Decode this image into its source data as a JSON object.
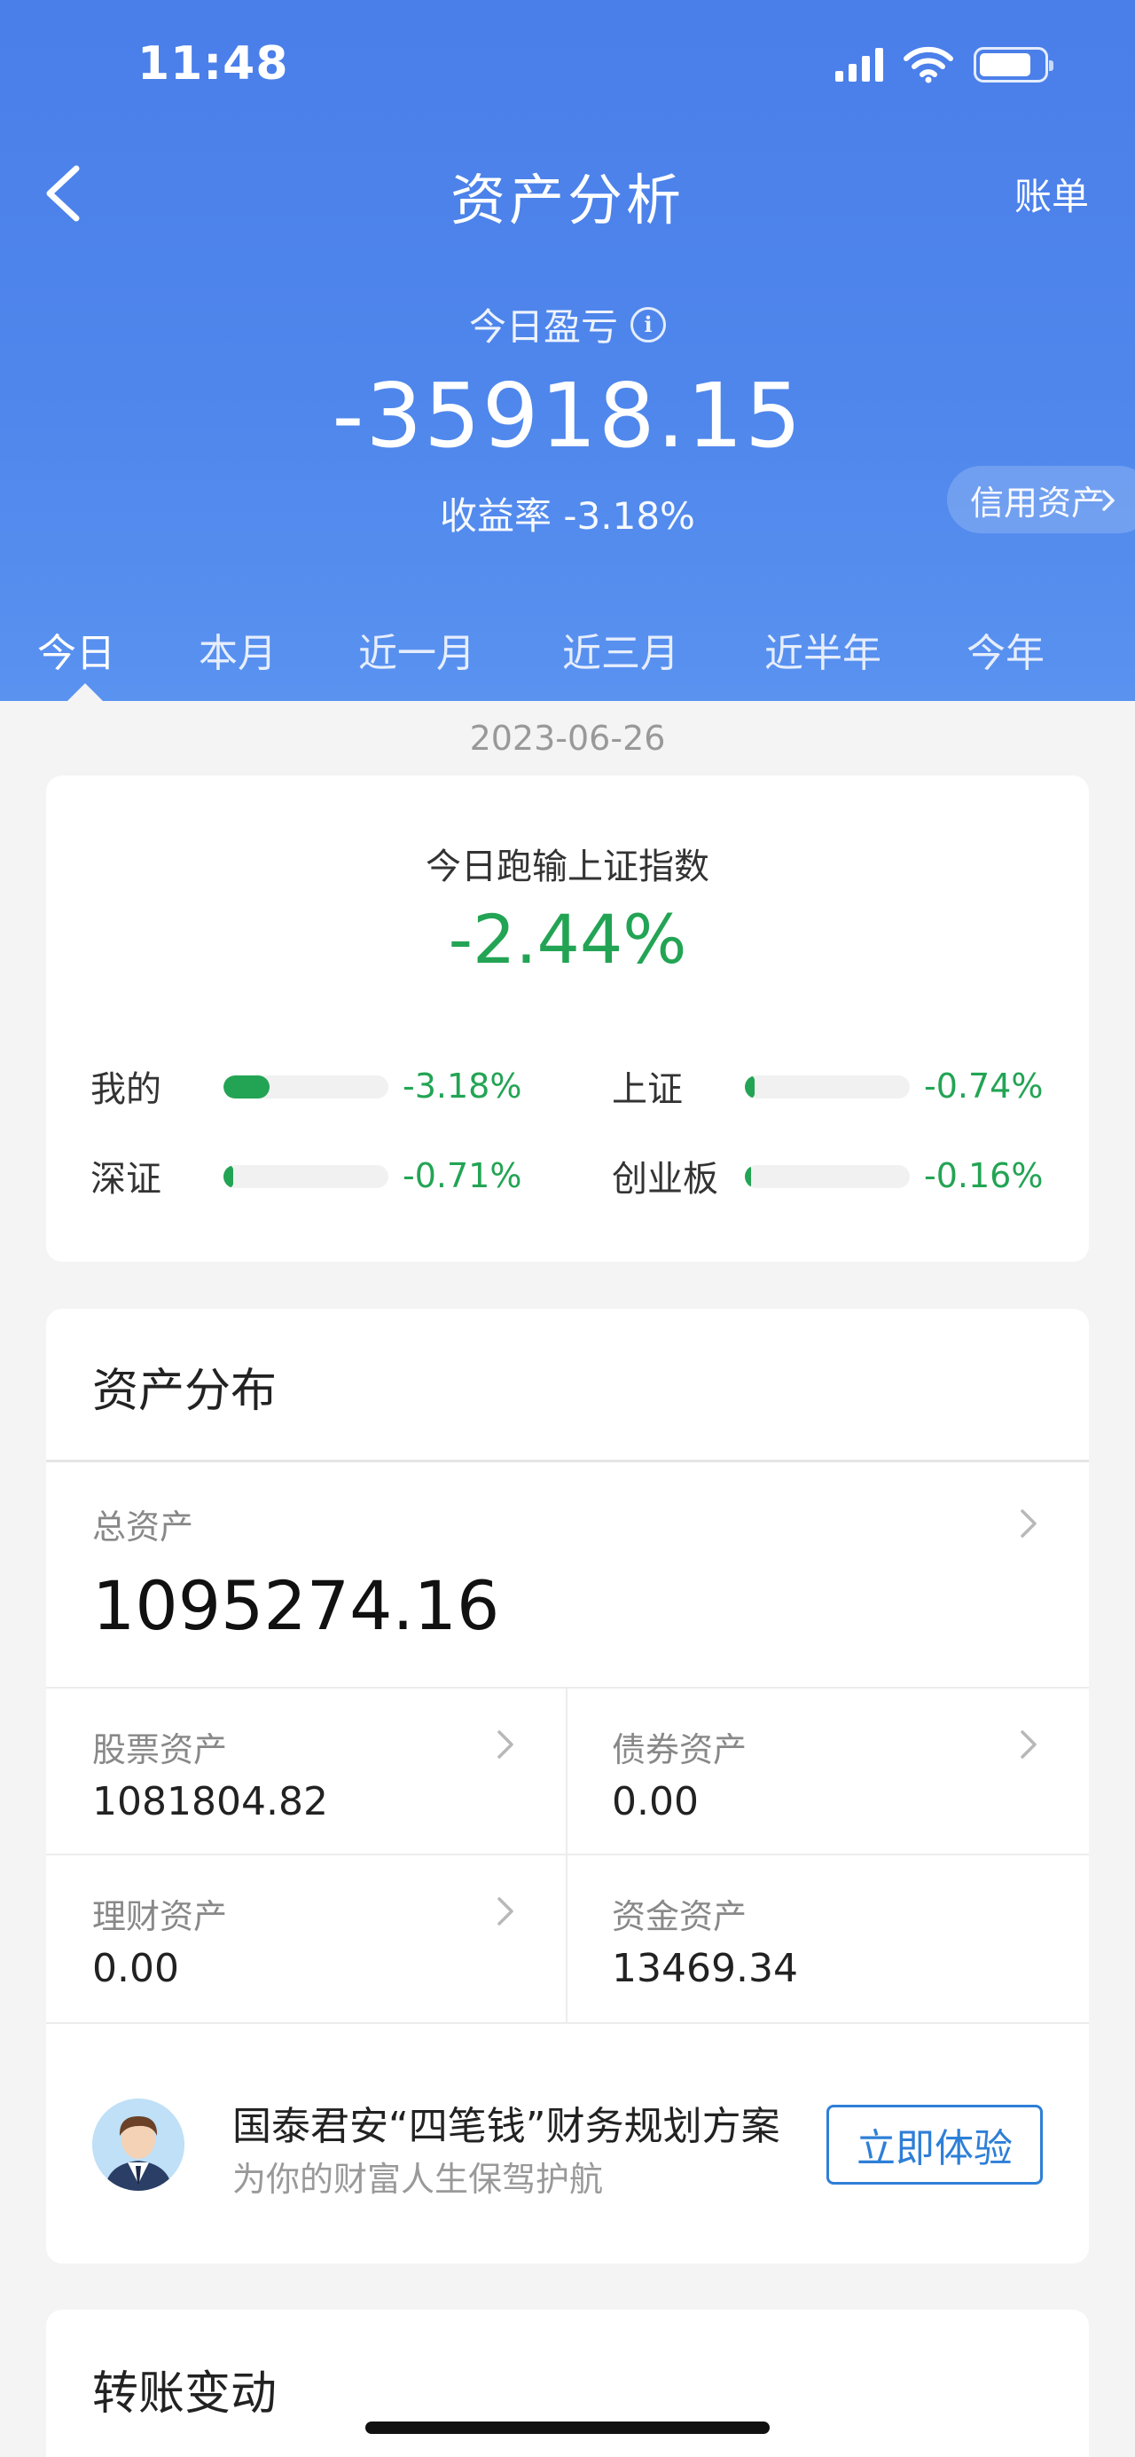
{
  "status_bar": {
    "time": "11:48"
  },
  "header": {
    "title": "资产分析",
    "right_action": "账单",
    "pl_label": "今日盈亏",
    "pl_value": "-35918.15",
    "yield_label": "收益率",
    "yield_value": "-3.18%",
    "credit_button": "信用资产"
  },
  "tabs": [
    {
      "label": "今日",
      "active": true
    },
    {
      "label": "本月"
    },
    {
      "label": "近一月"
    },
    {
      "label": "近三月"
    },
    {
      "label": "近半年"
    },
    {
      "label": "今年"
    }
  ],
  "date": "2023-06-26",
  "benchmark": {
    "title": "今日跑输上证指数",
    "value": "-2.44%",
    "items": [
      {
        "label": "我的",
        "value": "-3.18%",
        "ratio": 0.28
      },
      {
        "label": "上证",
        "value": "-0.74%",
        "ratio": 0.06
      },
      {
        "label": "深证",
        "value": "-0.71%",
        "ratio": 0.06
      },
      {
        "label": "创业板",
        "value": "-0.16%",
        "ratio": 0.02
      }
    ]
  },
  "assets": {
    "title": "资产分布",
    "total_label": "总资产",
    "total_value": "1095274.16",
    "cells": [
      {
        "label": "股票资产",
        "value": "1081804.82"
      },
      {
        "label": "债券资产",
        "value": "0.00"
      },
      {
        "label": "理财资产",
        "value": "0.00"
      },
      {
        "label": "资金资产",
        "value": "13469.34"
      }
    ],
    "promo": {
      "title": "国泰君安“四笔钱”财务规划方案",
      "subtitle": "为你的财富人生保驾护航",
      "button": "立即体验"
    }
  },
  "transfer": {
    "title": "转账变动"
  },
  "colors": {
    "header_blue": "#4a7ee9",
    "loss_green": "#23a454",
    "link_blue": "#2e7fd7"
  }
}
